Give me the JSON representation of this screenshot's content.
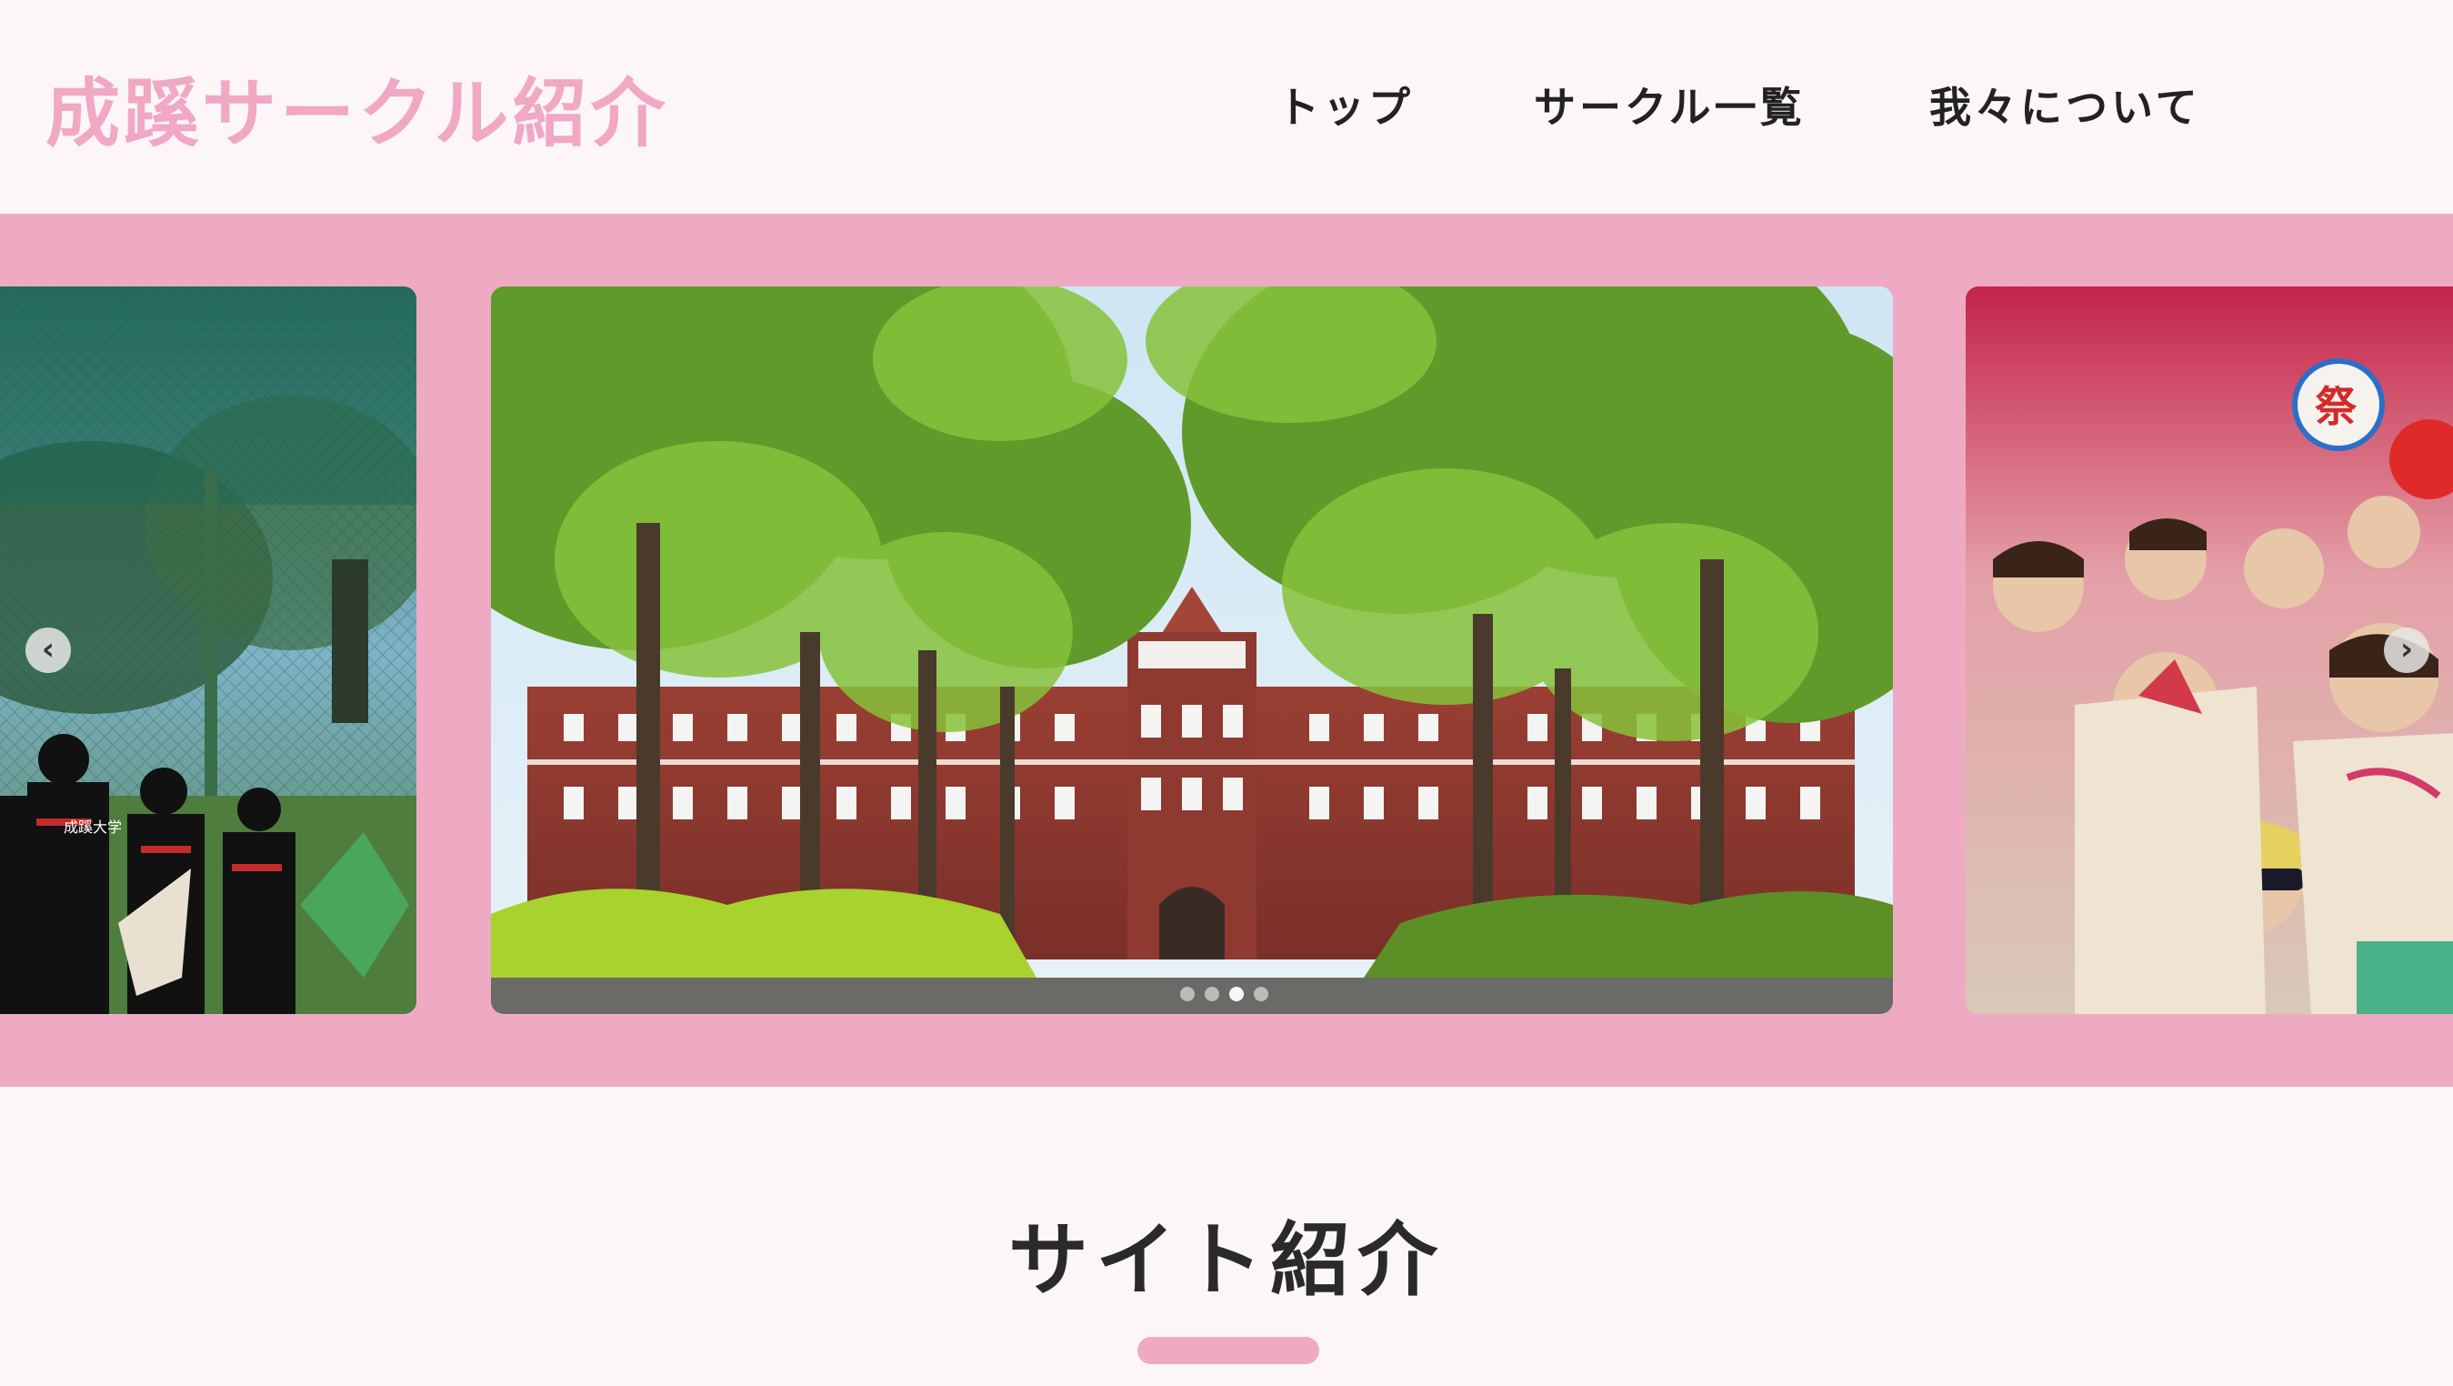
{
  "header": {
    "site_title": "成蹊サークル紹介",
    "nav": [
      {
        "label": "トップ"
      },
      {
        "label": "サークル一覧"
      },
      {
        "label": "我々について"
      }
    ]
  },
  "carousel": {
    "prev_glyph": "‹",
    "next_glyph": "›",
    "dot_count": 4,
    "active_dot": 3,
    "slides": [
      {
        "subject": "archery club members in black uniforms by a net",
        "printed_text": "成蹊大学"
      },
      {
        "subject": "red brick university building behind a tree-lined avenue"
      },
      {
        "subject": "crowd of students celebrating at a festival stage",
        "printed_text": "祭"
      }
    ]
  },
  "intro": {
    "heading": "サイト紹介"
  },
  "colors": {
    "accent_pink": "#eeaac3",
    "title_pink": "#f0a8c4",
    "background": "#fdf6f6",
    "text_dark": "#222222"
  }
}
